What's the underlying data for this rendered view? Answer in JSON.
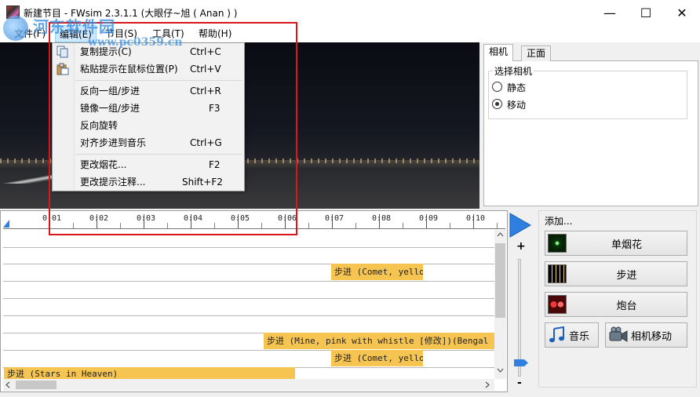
{
  "window": {
    "title": "新建节目 - FWsim 2.3.1.1 (大眼仔~旭 ( Anan ) )",
    "minimize_glyph": "—",
    "maximize_glyph": "☐",
    "close_glyph": "✕"
  },
  "menubar": {
    "file": "文件(F)",
    "edit": "编辑(E)",
    "show": "节目(S)",
    "tools": "工具(T)",
    "help": "帮助(H)"
  },
  "edit_menu": {
    "items": [
      {
        "label": "复制提示(C)",
        "shortcut": "Ctrl+C",
        "icon": "copy-icon"
      },
      {
        "label": "粘贴提示在鼠标位置(P)",
        "shortcut": "Ctrl+V",
        "icon": "paste-icon"
      },
      {
        "label": "反向一组/步进",
        "shortcut": "Ctrl+R"
      },
      {
        "label": "镜像一组/步进",
        "shortcut": "F3"
      },
      {
        "label": "反向旋转",
        "shortcut": ""
      },
      {
        "label": "对齐步进到音乐",
        "shortcut": "Ctrl+G"
      },
      {
        "label": "更改烟花...",
        "shortcut": "F2"
      },
      {
        "label": "更改提示注释...",
        "shortcut": "Shift+F2"
      }
    ]
  },
  "camera_panel": {
    "tabs": [
      "相机",
      "正面"
    ],
    "group_label": "选择相机",
    "options": [
      {
        "label": "静态",
        "checked": false
      },
      {
        "label": "移动",
        "checked": true
      }
    ]
  },
  "timeline": {
    "ticks": [
      "0:01",
      "0:02",
      "0:03",
      "0:04",
      "0:05",
      "0:06",
      "0:07",
      "0:08",
      "0:09",
      "0:10"
    ],
    "blocks": [
      "步进 (Comet, yellow",
      "步进 (Mine, pink with whistle [修改])(Bengal fla",
      "步进 (Comet, yellow",
      "步进 (Stars in Heaven)"
    ],
    "zoom_plus": "+",
    "zoom_minus": "-"
  },
  "add_panel": {
    "label": "添加...",
    "single_firework": "单烟花",
    "step": "步进",
    "rack": "炮台",
    "music": "音乐",
    "camera_move": "相机移动"
  },
  "watermark": {
    "text": "河东软件园",
    "url": "www.pc0359.cn"
  },
  "colors": {
    "highlight_box": "#d8161c",
    "block_fill": "#f6c451",
    "play_arrow": "#2f7fe0"
  }
}
